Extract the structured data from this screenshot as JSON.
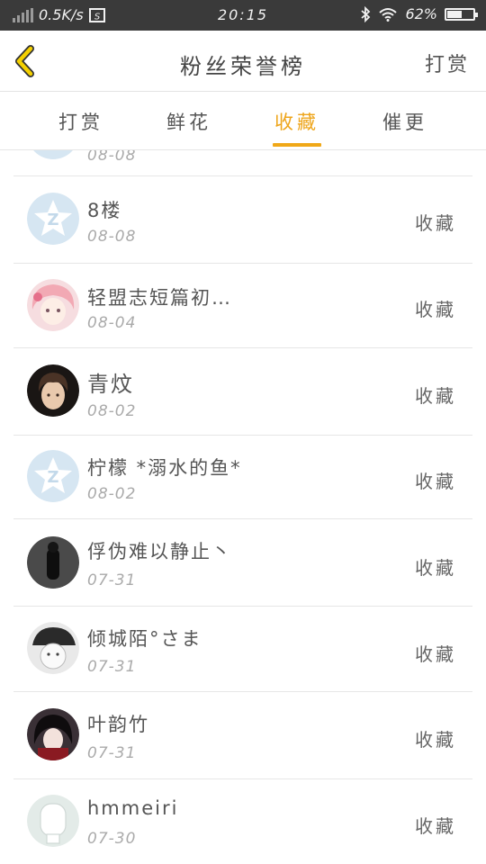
{
  "status_bar": {
    "speed": "0.5K/s",
    "time": "20:15",
    "battery": "62%",
    "battery_level": 0.62
  },
  "header": {
    "title": "粉丝荣誉榜",
    "action": "打赏"
  },
  "tabs": [
    "打赏",
    "鲜花",
    "收藏",
    "催更"
  ],
  "active_tab": 2,
  "list": {
    "partial_date": "08-08",
    "rows": [
      {
        "name": "8楼",
        "date": "08-08",
        "status": "收藏",
        "avatar": "default-avatar"
      },
      {
        "name": "轻盟志短篇初…",
        "date": "08-04",
        "status": "收藏",
        "avatar": "anime-girl-avatar"
      },
      {
        "name": "青炆",
        "date": "08-02",
        "status": "收藏",
        "avatar": "boy-avatar"
      },
      {
        "name": "柠檬 *溺水的鱼*",
        "date": "08-02",
        "status": "收藏",
        "avatar": "default-avatar"
      },
      {
        "name": "俘伪难以静止丶",
        "date": "07-31",
        "status": "收藏",
        "avatar": "dark-figure-avatar"
      },
      {
        "name": "倾城陌°さま",
        "date": "07-31",
        "status": "收藏",
        "avatar": "anime-cap-avatar"
      },
      {
        "name": "叶韵竹",
        "date": "07-31",
        "status": "收藏",
        "avatar": "anime-dark-avatar"
      },
      {
        "name": "hmmeiri",
        "date": "07-30",
        "status": "收藏",
        "avatar": "white-avatar"
      }
    ]
  },
  "colors": {
    "accent": "#f0a818",
    "status_bar_bg": "#3a3a3a",
    "back_arrow": "#e0b400",
    "default_avatar": "#d6e6f2"
  }
}
